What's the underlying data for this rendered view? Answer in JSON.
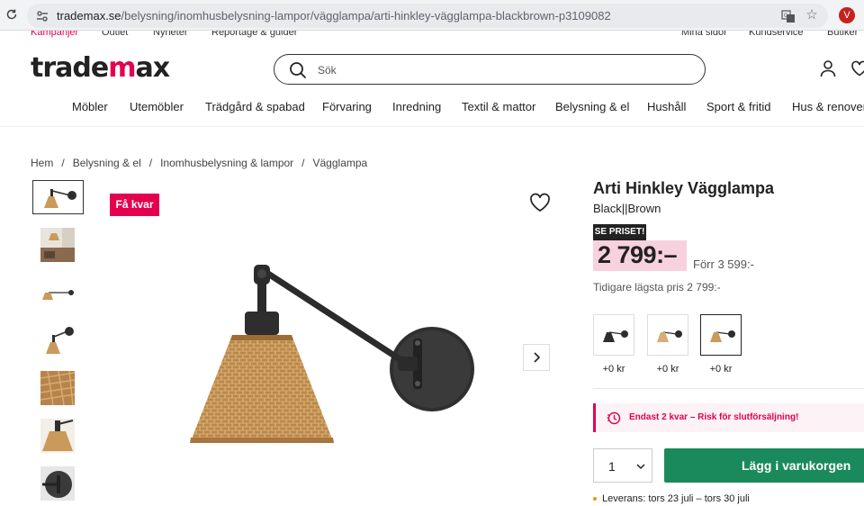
{
  "browser": {
    "url_domain": "trademax.se",
    "url_path": "/belysning/inomhusbelysning-lampor/vägglampa/arti-hinkley-vägglampa-blackbrown-p3109082",
    "profile_initial": "V"
  },
  "util_links": [
    "Kampanjer",
    "Outlet",
    "Nyheter",
    "Reportage & guider",
    "Mina sidor",
    "Kundservice",
    "Butiker"
  ],
  "header": {
    "logo_pre": "trade",
    "logo_x": "m",
    "logo_post": "ax",
    "search_placeholder": "Sök"
  },
  "nav": [
    "Möbler",
    "Utemöbler",
    "Trädgård & spabad",
    "Förvaring",
    "Inredning",
    "Textil & mattor",
    "Belysning & el",
    "Hushåll",
    "Sport & fritid",
    "Hus & renoveri"
  ],
  "breadcrumb": [
    "Hem",
    "Belysning & el",
    "Inomhusbelysning & lampor",
    "Vägglampa"
  ],
  "product": {
    "badge": "Få kvar",
    "title": "Arti Hinkley Vägglampa",
    "color": "Black||Brown",
    "se_priset": "SE PRISET!",
    "price": "2 799:–",
    "old_price": "Förr 3 599:-",
    "lowest_price": "Tidigare lägsta pris 2 799:-",
    "variants": [
      {
        "price": "+0 kr",
        "shade": "black"
      },
      {
        "price": "+0 kr",
        "shade": "rattan-light"
      },
      {
        "price": "+0 kr",
        "shade": "rattan-dark"
      }
    ],
    "stock_warning": "Endast 2 kvar – Risk för slutförsäljning!",
    "quantity": "1",
    "add_to_cart": "Lägg i varukorgen",
    "delivery": "Leverans: tors 23 juli – tors 30 juli"
  },
  "colors": {
    "brand_pink": "#e4004f",
    "cart_green": "#1b8a5a",
    "price_bg": "#f8d1df",
    "rattan": "#c99a5b",
    "lamp_metal": "#2e2e2e"
  }
}
